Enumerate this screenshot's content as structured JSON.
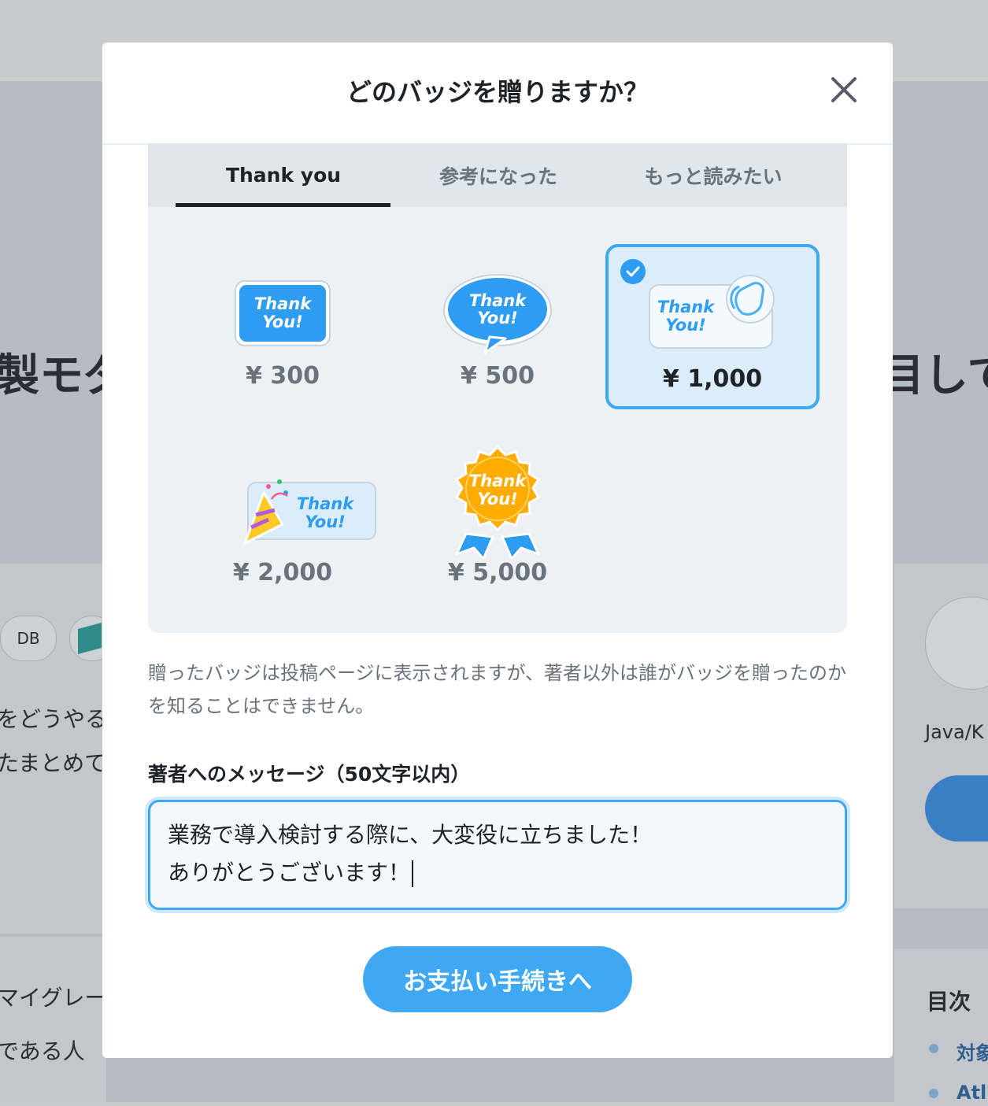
{
  "background": {
    "title_left": "製モダ",
    "title_right": "目して",
    "chip_db": "DB",
    "text_lines": [
      "をどうやる",
      "たまとめて",
      "マイグレー",
      "である人"
    ],
    "author": "Java/K",
    "toc_title": "目次",
    "toc_items": [
      "対象",
      "Atl"
    ]
  },
  "modal": {
    "title": "どのバッジを贈りますか？",
    "tabs": [
      {
        "label": "Thank you",
        "active": true
      },
      {
        "label": "参考になった",
        "active": false
      },
      {
        "label": "もっと読みたい",
        "active": false
      }
    ],
    "badges": [
      {
        "text1": "Thank",
        "text2": "You!",
        "price": "¥ 300",
        "style": "tag",
        "selected": false
      },
      {
        "text1": "Thank",
        "text2": "You!",
        "price": "¥ 500",
        "style": "bubble",
        "selected": false
      },
      {
        "text1": "Thank",
        "text2": "You!",
        "price": "¥ 1,000",
        "style": "clap",
        "selected": true
      },
      {
        "text1": "Thank",
        "text2": "You!",
        "price": "¥ 2,000",
        "style": "party",
        "selected": false
      },
      {
        "text1": "Thank",
        "text2": "You!",
        "price": "¥ 5,000",
        "style": "medal",
        "selected": false
      }
    ],
    "note": "贈ったバッジは投稿ページに表示されますが、著者以外は誰がバッジを贈ったのかを知ることはできません。",
    "message_label": "著者へのメッセージ（50文字以内）",
    "message_line1": "業務で導入検討する際に、大変役に立ちました！",
    "message_line2": "ありがとうございます！",
    "pay_button": "お支払い手続きへ"
  },
  "colors": {
    "accent": "#3ea8f4",
    "selected_bg": "#dbecfb",
    "medal": "#ffab00"
  }
}
